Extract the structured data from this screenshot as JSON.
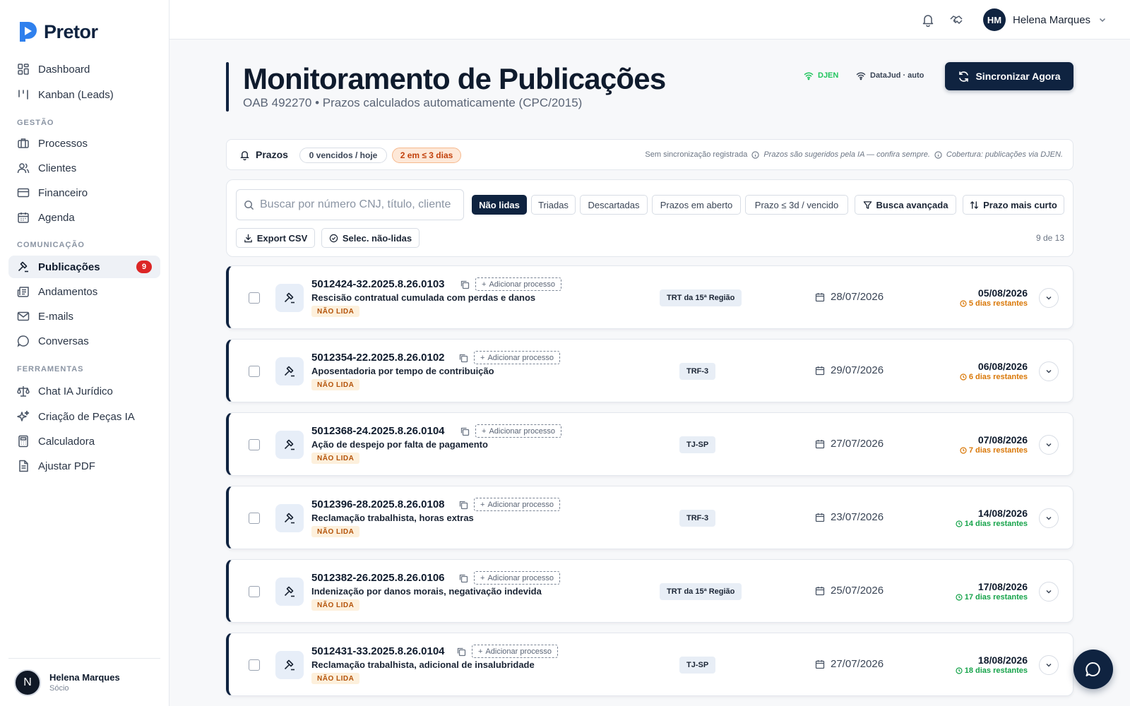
{
  "app": {
    "name": "Pretor",
    "brand_color": "#0f2340",
    "accent_color": "#2f80ed"
  },
  "sidebar": {
    "items_top": [
      {
        "label": "Dashboard",
        "icon": "dashboard-grid-icon"
      },
      {
        "label": "Kanban (Leads)",
        "icon": "kanban-icon"
      }
    ],
    "sections": [
      "GESTÃO",
      "COMUNICAÇÃO",
      "FERRAMENTAS"
    ],
    "gestao": [
      {
        "label": "Processos",
        "icon": "briefcase-icon"
      },
      {
        "label": "Clientes",
        "icon": "users-icon"
      },
      {
        "label": "Financeiro",
        "icon": "credit-card-icon"
      },
      {
        "label": "Agenda",
        "icon": "calendar-icon"
      }
    ],
    "comunicacao": [
      {
        "label": "Publicações",
        "icon": "gavel-icon",
        "badge": "9",
        "active": true
      },
      {
        "label": "Andamentos",
        "icon": "newspaper-icon"
      },
      {
        "label": "E-mails",
        "icon": "mail-icon"
      },
      {
        "label": "Conversas",
        "icon": "chat-bubble-icon"
      }
    ],
    "ferramentas": [
      {
        "label": "Chat IA Jurídico",
        "icon": "scale-icon"
      },
      {
        "label": "Criação de Peças IA",
        "icon": "sparkles-icon"
      },
      {
        "label": "Calculadora",
        "icon": "calculator-icon"
      },
      {
        "label": "Ajustar PDF",
        "icon": "file-icon"
      }
    ],
    "footer": {
      "avatar_letter": "N",
      "name": "Helena Marques",
      "role": "Sócio"
    }
  },
  "topbar": {
    "user_initials": "HM",
    "user_name": "Helena Marques"
  },
  "header": {
    "title": "Monitoramento de Publicações",
    "subtitle": "OAB 492270 • Prazos calculados automaticamente (CPC/2015)",
    "status_djen": "DJEN",
    "status_datajud": "DataJud · auto",
    "sync_button": "Sincronizar Agora",
    "status_green": "#22c55e"
  },
  "prazos": {
    "label": "Prazos",
    "pill_vencidos": "0 vencidos / hoje",
    "pill_proximos": "2 em ≤ 3 dias",
    "sync_info": "Sem sincronização registrada",
    "ia_info": "Prazos são sugeridos pela IA — confira sempre.",
    "coverage_info": "Cobertura: publicações via DJEN."
  },
  "filters": {
    "search_placeholder": "Buscar por número CNJ, título, cliente",
    "tabs": [
      "Não lidas",
      "Triadas",
      "Descartadas",
      "Prazos em aberto",
      "Prazo ≤ 3d / vencido"
    ],
    "advanced": "Busca avançada",
    "sort": "Prazo mais curto",
    "export": "Export CSV",
    "select_unread": "Selec. não-lidas",
    "count": "9 de 13"
  },
  "rows": [
    {
      "number": "5012424-32.2025.8.26.0103",
      "add_label": "Adicionar processo",
      "title": "Rescisão contratual cumulada com perdas e danos",
      "badge": "NÃO LIDA",
      "court": "TRT da 15ª Região",
      "pub_date": "28/07/2026",
      "deadline": "05/08/2026",
      "remaining": "5 dias restantes",
      "urgency": "warn"
    },
    {
      "number": "5012354-22.2025.8.26.0102",
      "add_label": "Adicionar processo",
      "title": "Aposentadoria por tempo de contribuição",
      "badge": "NÃO LIDA",
      "court": "TRF-3",
      "pub_date": "29/07/2026",
      "deadline": "06/08/2026",
      "remaining": "6 dias restantes",
      "urgency": "warn"
    },
    {
      "number": "5012368-24.2025.8.26.0104",
      "add_label": "Adicionar processo",
      "title": "Ação de despejo por falta de pagamento",
      "badge": "NÃO LIDA",
      "court": "TJ-SP",
      "pub_date": "27/07/2026",
      "deadline": "07/08/2026",
      "remaining": "7 dias restantes",
      "urgency": "warn"
    },
    {
      "number": "5012396-28.2025.8.26.0108",
      "add_label": "Adicionar processo",
      "title": "Reclamação trabalhista, horas extras",
      "badge": "NÃO LIDA",
      "court": "TRF-3",
      "pub_date": "23/07/2026",
      "deadline": "14/08/2026",
      "remaining": "14 dias restantes",
      "urgency": "ok"
    },
    {
      "number": "5012382-26.2025.8.26.0106",
      "add_label": "Adicionar processo",
      "title": "Indenização por danos morais, negativação indevida",
      "badge": "NÃO LIDA",
      "court": "TRT da 15ª Região",
      "pub_date": "25/07/2026",
      "deadline": "17/08/2026",
      "remaining": "17 dias restantes",
      "urgency": "ok"
    },
    {
      "number": "5012431-33.2025.8.26.0104",
      "add_label": "Adicionar processo",
      "title": "Reclamação trabalhista, adicional de insalubridade",
      "badge": "NÃO LIDA",
      "court": "TJ-SP",
      "pub_date": "27/07/2026",
      "deadline": "18/08/2026",
      "remaining": "18 dias restantes",
      "urgency": "ok"
    }
  ]
}
